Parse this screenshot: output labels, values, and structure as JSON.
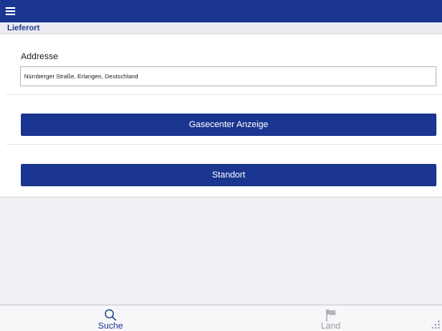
{
  "header": {
    "menu_icon": "hamburger-menu-icon"
  },
  "section": {
    "title": "Lieferort"
  },
  "address": {
    "label": "Addresse",
    "value": "Nürnberger Straße, Erlangen, Deutschland"
  },
  "buttons": {
    "gasecenter": "Gasecenter Anzeige",
    "standort": "Standort"
  },
  "tabs": [
    {
      "label": "Suche",
      "icon": "search-icon",
      "active": true,
      "color": "#1a3690"
    },
    {
      "label": "Land",
      "icon": "flag-icon",
      "active": false,
      "color": "#9a9aa0"
    }
  ],
  "colors": {
    "primary": "#1a3690",
    "background": "#efeff4"
  }
}
